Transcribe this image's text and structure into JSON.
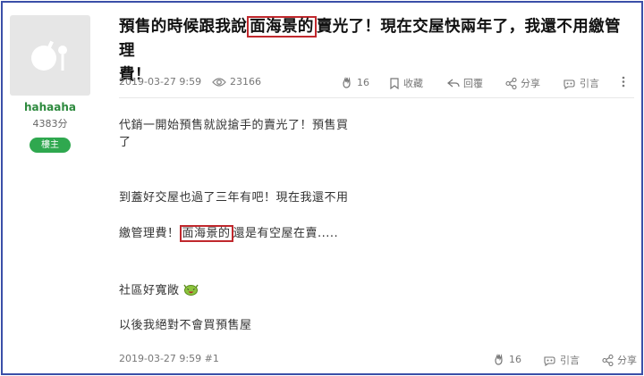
{
  "user": {
    "name": "hahaaha",
    "points": "4383分",
    "badge": "樓主"
  },
  "post": {
    "title_before": "預售的時候跟我說",
    "title_highlight": "面海景的",
    "title_after_line1": "賣光了！現在交屋快兩年了，我還不用繳管理",
    "title_line2": "費！",
    "datetime": "2019-03-27 9:59",
    "views": "23166",
    "likes": "16",
    "actions": {
      "bookmark": "收藏",
      "reply": "回覆",
      "share": "分享",
      "quote": "引言"
    },
    "body": {
      "line1": "代銷一開始預售就說搶手的賣光了！預售買",
      "line2": "了",
      "line3": "到蓋好交屋也過了三年有吧！現在我還不用",
      "line4_before": "繳管理費！",
      "line4_highlight": "面海景的",
      "line4_after": "還是有空屋在賣.....",
      "line5": "社區好寬敞",
      "line6": "以後我絕對不會買預售屋"
    },
    "footer": {
      "datetime_floor": "2019-03-27 9:59 #1",
      "likes": "16",
      "quote": "引言",
      "share": "分享"
    }
  },
  "colors": {
    "border": "#3b4fa8",
    "highlight": "#c0282d",
    "username": "#2d8a3e",
    "badge": "#2fa84f"
  }
}
